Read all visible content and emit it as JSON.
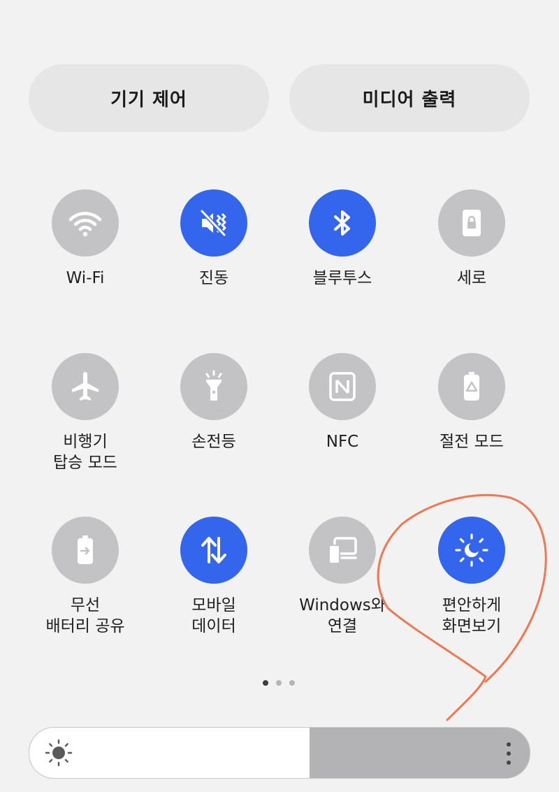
{
  "top_buttons": {
    "device_control": "기기 제어",
    "media_output": "미디어 출력"
  },
  "tiles": [
    {
      "label": "Wi-Fi",
      "icon": "wifi-icon",
      "active": false
    },
    {
      "label": "진동",
      "icon": "vibrate-icon",
      "active": true
    },
    {
      "label": "블루투스",
      "icon": "bluetooth-icon",
      "active": true
    },
    {
      "label": "세로",
      "icon": "portrait-lock-icon",
      "active": false
    },
    {
      "label": "비행기\n탑승 모드",
      "icon": "airplane-icon",
      "active": false
    },
    {
      "label": "손전등",
      "icon": "flashlight-icon",
      "active": false
    },
    {
      "label": "NFC",
      "icon": "nfc-icon",
      "active": false
    },
    {
      "label": "절전 모드",
      "icon": "power-saving-icon",
      "active": false
    },
    {
      "label": "무선\n배터리 공유",
      "icon": "wireless-battery-share-icon",
      "active": false
    },
    {
      "label": "모바일\n데이터",
      "icon": "mobile-data-icon",
      "active": true
    },
    {
      "label": "Windows와\n연결",
      "icon": "link-to-windows-icon",
      "active": false
    },
    {
      "label": "편안하게\n화면보기",
      "icon": "eye-comfort-icon",
      "active": true
    }
  ],
  "pagination": {
    "pages": 3,
    "current": 1
  },
  "brightness": {
    "level": 0.56
  },
  "colors": {
    "active_tile": "#3366ec",
    "inactive_tile": "#c3c3c5",
    "annotation": "#f07850"
  }
}
